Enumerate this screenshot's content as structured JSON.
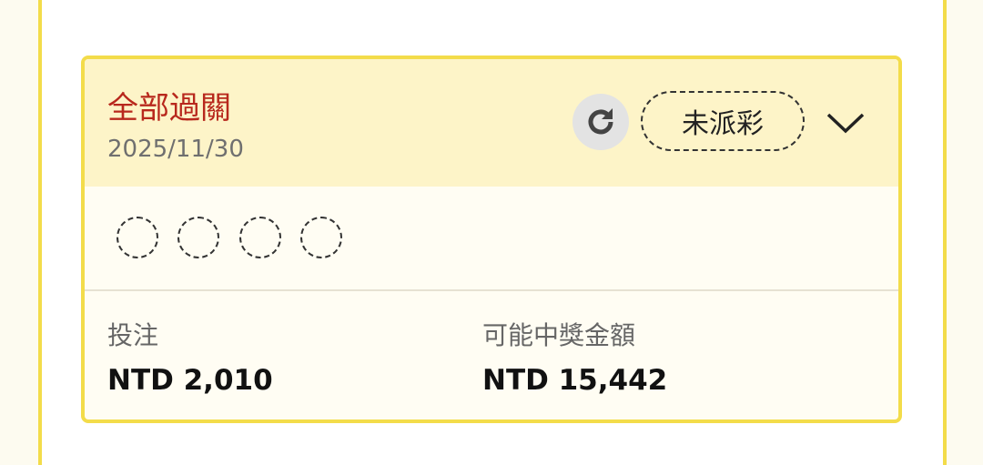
{
  "card": {
    "bet_type": "全部過關",
    "date": "2025/11/30",
    "status": "未派彩",
    "legs_count": 4,
    "stake_label": "投注",
    "stake_value": "NTD 2,010",
    "payout_label": "可能中獎金額",
    "payout_value": "NTD 15,442"
  },
  "icons": {
    "refresh": "refresh-icon",
    "expand": "chevron-down-icon"
  },
  "colors": {
    "accent_border": "#f3dc4a",
    "header_bg": "#fdf4c8",
    "bet_type_text": "#b8281d"
  }
}
